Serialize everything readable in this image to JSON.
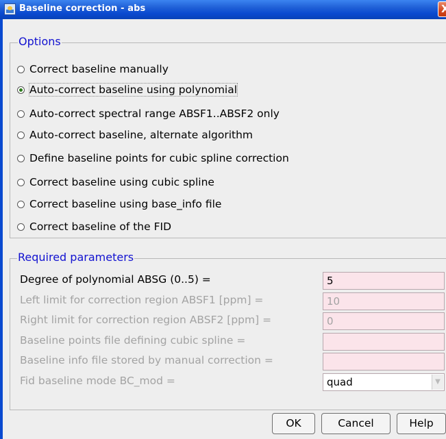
{
  "window": {
    "title": "Baseline correction - abs",
    "close_glyph": "X"
  },
  "options": {
    "legend": "Options",
    "items": [
      {
        "label": "Correct baseline manually",
        "checked": false
      },
      {
        "label": "Auto-correct baseline using polynomial",
        "checked": true
      },
      {
        "label": "Auto-correct spectral range ABSF1..ABSF2 only",
        "checked": false
      },
      {
        "label": "Auto-correct baseline, alternate algorithm",
        "checked": false
      },
      {
        "label": "Define baseline points for cubic spline correction",
        "checked": false
      },
      {
        "label": "Correct baseline using cubic spline",
        "checked": false
      },
      {
        "label": "Correct baseline using base_info file",
        "checked": false
      },
      {
        "label": "Correct baseline of the FID",
        "checked": false
      }
    ]
  },
  "params": {
    "legend": "Required parameters",
    "rows": [
      {
        "label": "Degree of polynomial ABSG (0..5) =",
        "value": "5",
        "enabled": true
      },
      {
        "label": "Left limit for correction region ABSF1 [ppm] =",
        "value": "10",
        "enabled": false
      },
      {
        "label": "Right limit for correction region ABSF2 [ppm] =",
        "value": "0",
        "enabled": false
      },
      {
        "label": "Baseline points file defining cubic spline =",
        "value": "",
        "enabled": false
      },
      {
        "label": "Baseline info file stored by manual correction =",
        "value": "",
        "enabled": false
      },
      {
        "label": "Fid baseline mode BC_mod =",
        "value": "quad",
        "enabled": false
      }
    ]
  },
  "buttons": {
    "ok": "OK",
    "cancel": "Cancel",
    "help": "Help"
  },
  "colors": {
    "legend": "#1212d0",
    "field_bg": "#fbe4ea",
    "disabled_text": "#a3a3a3",
    "titlebar": "#0a4ad0"
  }
}
